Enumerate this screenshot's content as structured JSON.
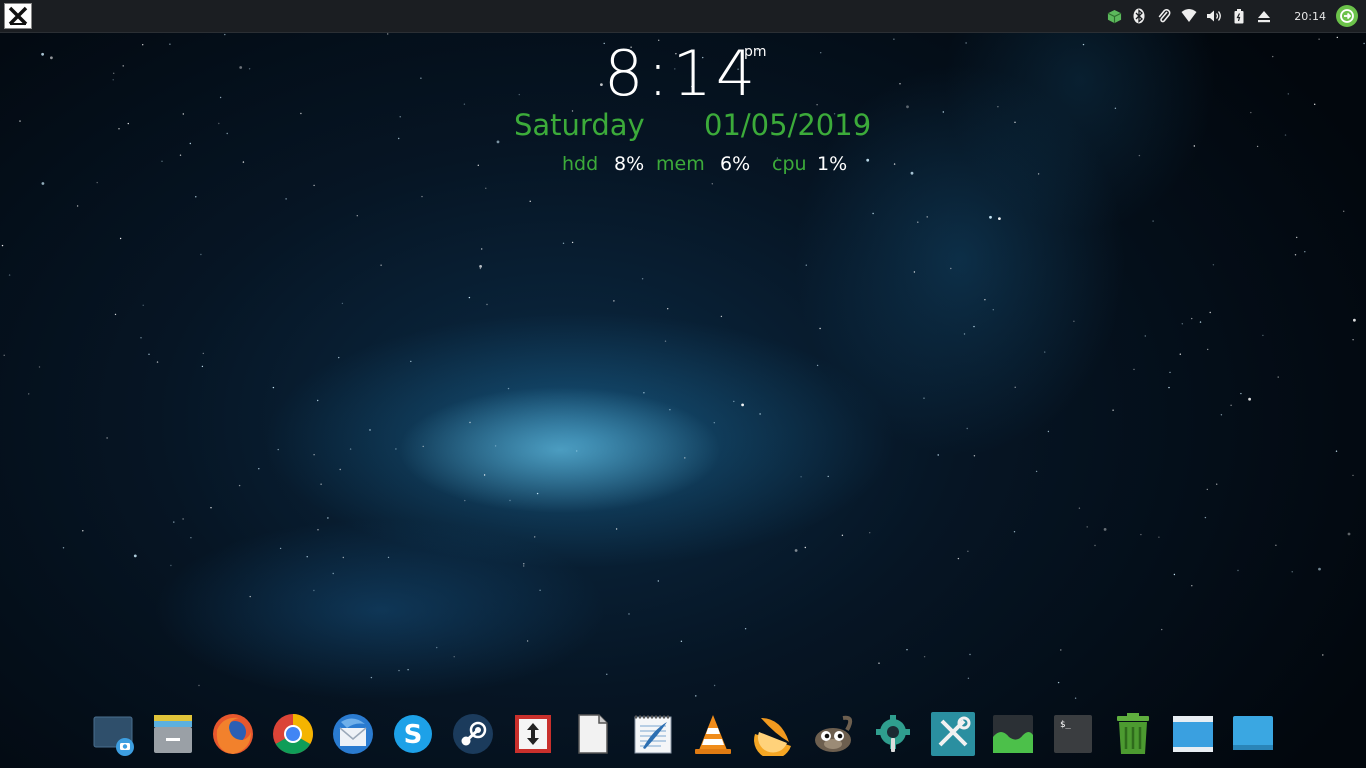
{
  "panel": {
    "clock": "20:14",
    "tray_icons": [
      "cube-icon",
      "bluetooth-icon",
      "paperclip-icon",
      "wifi-icon",
      "volume-icon",
      "battery-icon",
      "eject-icon"
    ]
  },
  "conky": {
    "time": "8:14",
    "ampm": "pm",
    "day": "Saturday",
    "date": "01/05/2019",
    "stats": [
      {
        "label": "hdd",
        "value": "8%"
      },
      {
        "label": "mem",
        "value": "6%"
      },
      {
        "label": "cpu",
        "value": "1%"
      }
    ]
  },
  "dock": {
    "items": [
      "screenshot-icon",
      "file-manager-icon",
      "firefox-icon",
      "chrome-icon",
      "thunderbird-icon",
      "skype-icon",
      "steam-icon",
      "transmission-icon",
      "text-document-icon",
      "text-editor-icon",
      "vlc-icon",
      "orange-icon",
      "gimp-icon",
      "settings-icon",
      "system-tools-icon",
      "system-monitor-icon",
      "terminal-icon",
      "trash-icon",
      "window-icon",
      "desktop-icon"
    ]
  },
  "colors": {
    "accent_green": "#3cab3a",
    "panel_bg": "#1b1e22",
    "power_green": "#6bc24a"
  }
}
